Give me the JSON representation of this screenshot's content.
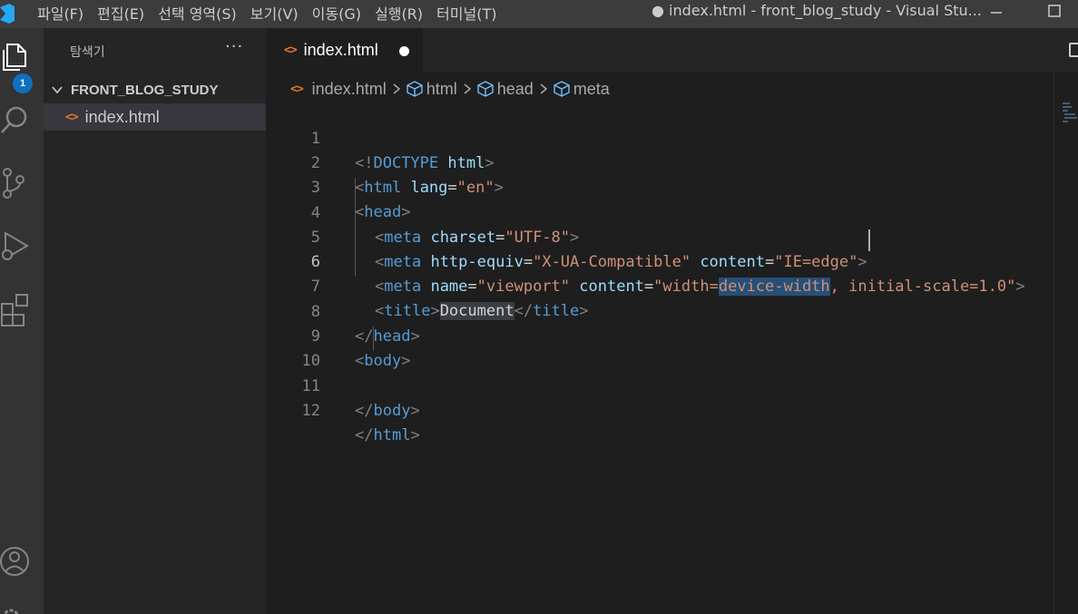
{
  "menu": {
    "items": [
      "파일(F)",
      "편집(E)",
      "선택 영역(S)",
      "보기(V)",
      "이동(G)",
      "실행(R)",
      "터미널(T)"
    ]
  },
  "window": {
    "title": "● index.html - front_blog_study - Visual Stu..."
  },
  "activity_bar": {
    "explorer_badge": "1",
    "icons": [
      "files-icon",
      "search-icon",
      "source-control-icon",
      "run-debug-icon",
      "extensions-icon",
      "account-icon",
      "settings-gear-icon"
    ]
  },
  "sidebar": {
    "title": "탐색기",
    "more": "···",
    "folder": "FRONT_BLOG_STUDY",
    "files": [
      {
        "name": "index.html"
      }
    ]
  },
  "editor": {
    "tab_label": "index.html",
    "breadcrumbs": [
      "index.html",
      "html",
      "head",
      "meta"
    ],
    "active_line": 6,
    "line_numbers": [
      "1",
      "2",
      "3",
      "4",
      "5",
      "6",
      "7",
      "8",
      "9",
      "10",
      "11",
      "12"
    ],
    "code": {
      "l1": [
        "<!",
        "DOCTYPE",
        " ",
        "html",
        ">"
      ],
      "l2": [
        "<",
        "html",
        " ",
        "lang",
        "=",
        "\"en\"",
        ">"
      ],
      "l3": [
        "<",
        "head",
        ">"
      ],
      "l4": [
        "<",
        "meta",
        " ",
        "charset",
        "=",
        "\"UTF-8\"",
        ">"
      ],
      "l5": [
        "<",
        "meta",
        " ",
        "http-equiv",
        "=",
        "\"X-UA-Compatible\"",
        " ",
        "content",
        "=",
        "\"IE=edge\"",
        ">"
      ],
      "l6": [
        "<",
        "meta",
        " ",
        "name",
        "=",
        "\"viewport\"",
        " ",
        "content",
        "=",
        "\"width=",
        "device-width",
        ", initial-scale=1.0\"",
        ">"
      ],
      "l7": [
        "<",
        "title",
        ">",
        "Document",
        "</",
        "title",
        ">"
      ],
      "l8": [
        "</",
        "head",
        ">"
      ],
      "l9": [
        "<",
        "body",
        ">"
      ],
      "l11": [
        "</",
        "body",
        ">"
      ],
      "l12": [
        "</",
        "html",
        ">"
      ]
    }
  }
}
